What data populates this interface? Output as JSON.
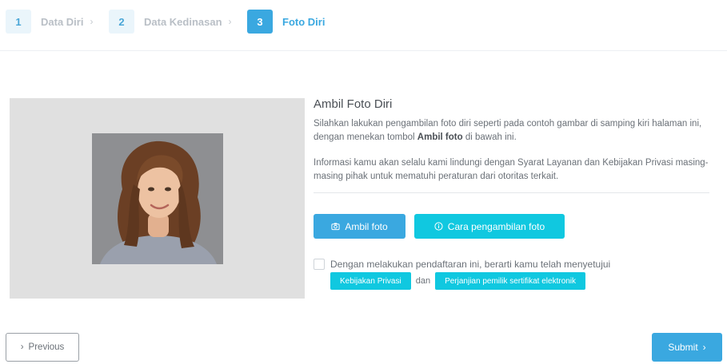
{
  "stepper": {
    "steps": [
      {
        "number": "1",
        "label": "Data Diri",
        "chevron": "›"
      },
      {
        "number": "2",
        "label": "Data Kedinasan",
        "chevron": "›"
      },
      {
        "number": "3",
        "label": "Foto Diri"
      }
    ],
    "active_step": 3
  },
  "photo": {
    "icon": "sample-portrait-image"
  },
  "content": {
    "title": "Ambil Foto Diri",
    "instruction_part1": "Silahkan lakukan pengambilan foto diri seperti pada contoh gambar di samping kiri halaman ini, dengan menekan tombol ",
    "instruction_bold": "Ambil foto",
    "instruction_part2": " di bawah ini.",
    "privacy_note": "Informasi kamu akan selalu kami lindungi dengan Syarat Layanan dan Kebijakan Privasi masing-masing pihak untuk mematuhi peraturan dari otoritas terkait."
  },
  "actions": {
    "take_photo_label": "Ambil foto",
    "take_photo_icon": "camera-icon",
    "how_to_label": "Cara pengambilan foto",
    "how_to_icon": "info-circle-icon"
  },
  "consent": {
    "text": "Dengan melakukan pendaftaran ini, berarti kamu telah menyetujui",
    "privacy_link": "Kebijakan Privasi",
    "connector": "dan",
    "agreement_link": "Perjanjian pemilik sertifikat elektronik"
  },
  "navigation": {
    "previous_label": "Previous",
    "previous_icon": "›",
    "submit_label": "Submit",
    "submit_icon": "›"
  },
  "colors": {
    "primary": "#3aa8e0",
    "accent": "#10c8e0"
  }
}
